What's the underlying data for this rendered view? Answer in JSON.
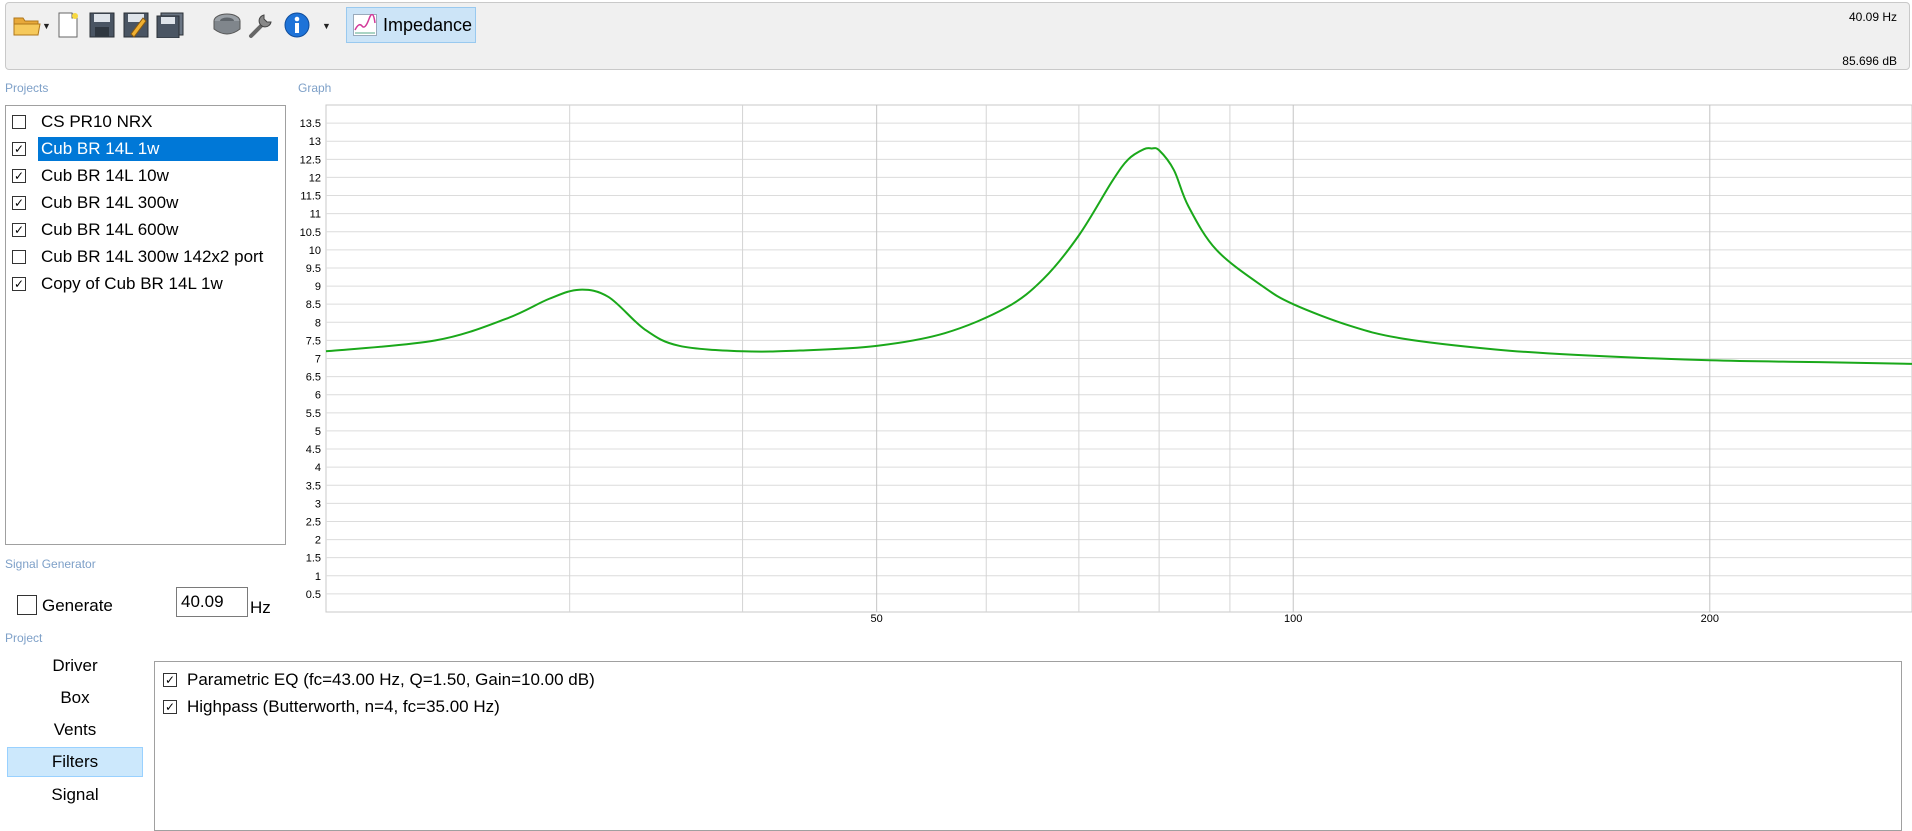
{
  "toolbar": {
    "buttons": [
      {
        "name": "open-folder-icon"
      },
      {
        "name": "new-file-icon"
      },
      {
        "name": "save-icon"
      },
      {
        "name": "save-as-icon"
      },
      {
        "name": "save-all-icon"
      },
      {
        "name": "speaker-driver-icon"
      },
      {
        "name": "tools-icon"
      },
      {
        "name": "info-icon"
      }
    ],
    "impedance_label": "Impedance",
    "freq_readout": "40.09 Hz",
    "db_readout": "85.696 dB"
  },
  "sections": {
    "projects": "Projects",
    "graph": "Graph",
    "signal_generator": "Signal Generator",
    "project": "Project"
  },
  "projects": {
    "items": [
      {
        "label": "CS PR10 NRX",
        "checked": false,
        "selected": false
      },
      {
        "label": "Cub BR 14L 1w",
        "checked": true,
        "selected": true
      },
      {
        "label": "Cub BR 14L 10w",
        "checked": true,
        "selected": false
      },
      {
        "label": "Cub BR 14L 300w",
        "checked": true,
        "selected": false
      },
      {
        "label": "Cub BR 14L 600w",
        "checked": true,
        "selected": false
      },
      {
        "label": "Cub BR 14L 300w 142x2 port",
        "checked": false,
        "selected": false
      },
      {
        "label": "Copy of Cub BR 14L 1w",
        "checked": true,
        "selected": false
      }
    ]
  },
  "signal_generator": {
    "generate_label": "Generate",
    "generate_checked": false,
    "frequency_value": "40.09",
    "frequency_unit": "Hz"
  },
  "project_nav": {
    "items": [
      "Driver",
      "Box",
      "Vents",
      "Filters",
      "Signal"
    ],
    "active": "Filters"
  },
  "filters": {
    "items": [
      {
        "label": "Parametric EQ (fc=43.00 Hz, Q=1.50, Gain=10.00 dB)",
        "checked": true
      },
      {
        "label": "Highpass (Butterworth, n=4, fc=35.00 Hz)",
        "checked": true
      }
    ]
  },
  "chart_data": {
    "type": "line",
    "title": "",
    "xlabel": "",
    "ylabel": "",
    "x_scale": "log",
    "xlim": [
      20,
      280
    ],
    "ylim": [
      0,
      14
    ],
    "y_ticks": [
      0.5,
      1,
      1.5,
      2,
      2.5,
      3,
      3.5,
      4,
      4.5,
      5,
      5.5,
      6,
      6.5,
      7,
      7.5,
      8,
      8.5,
      9,
      9.5,
      10,
      10.5,
      11,
      11.5,
      12,
      12.5,
      13,
      13.5
    ],
    "x_tick_labels": [
      50,
      100,
      200
    ],
    "x_minor_gridlines": [
      30,
      40,
      60,
      70,
      80,
      90
    ],
    "grid": true,
    "line_color": "#1aa81a",
    "series": [
      {
        "x": [
          20,
          24,
          27,
          29,
          30.5,
          32,
          34,
          36,
          40,
          44,
          50,
          56,
          62,
          66,
          70,
          74,
          76,
          78,
          79,
          80,
          82,
          84,
          88,
          95,
          100,
          110,
          120,
          140,
          160,
          200,
          240,
          280
        ],
        "values": [
          7.2,
          7.5,
          8.1,
          8.65,
          8.9,
          8.7,
          7.8,
          7.35,
          7.2,
          7.22,
          7.35,
          7.7,
          8.4,
          9.2,
          10.4,
          11.9,
          12.5,
          12.78,
          12.8,
          12.75,
          12.2,
          11.2,
          10.0,
          9.0,
          8.5,
          7.9,
          7.55,
          7.25,
          7.1,
          6.95,
          6.9,
          6.85
        ]
      }
    ]
  }
}
